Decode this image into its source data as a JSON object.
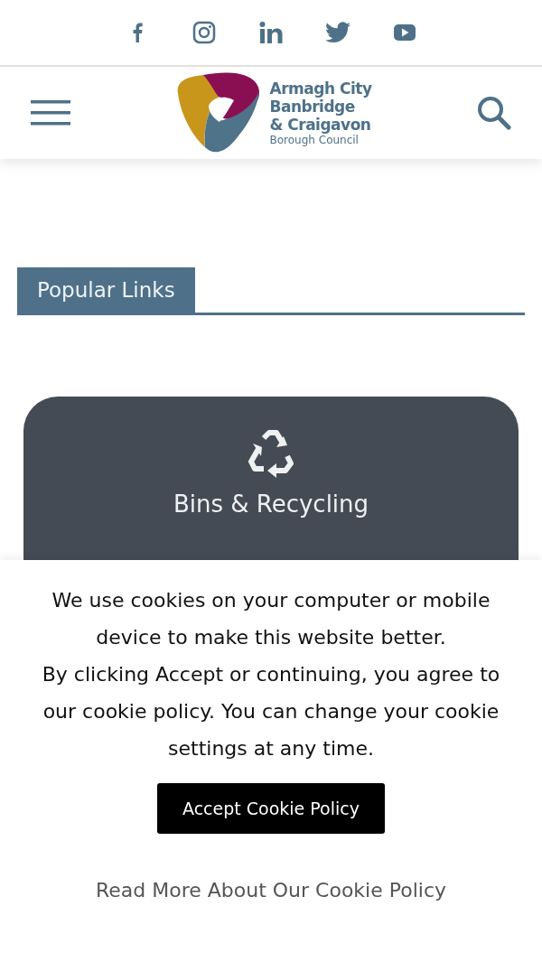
{
  "social_links": [
    {
      "kind": "facebook"
    },
    {
      "kind": "instagram"
    },
    {
      "kind": "linkedin"
    },
    {
      "kind": "twitter"
    },
    {
      "kind": "youtube"
    }
  ],
  "header": {
    "logo_lines": [
      "Armagh City",
      "Banbridge",
      "& Craigavon"
    ],
    "logo_subtitle": "Borough Council"
  },
  "section": {
    "title": "Popular Links"
  },
  "cards": [
    {
      "label": "Bins & Recycling",
      "kind": "recycling"
    }
  ],
  "cookie_banner": {
    "message": "We use cookies on your computer or mobile device to make this website better.",
    "detail": "By clicking Accept or continuing, you agree to our cookie policy. You can change your cookie settings at any time.",
    "accept_button": "Accept Cookie Policy",
    "read_more_link": "Read More About Our Cookie Policy"
  }
}
